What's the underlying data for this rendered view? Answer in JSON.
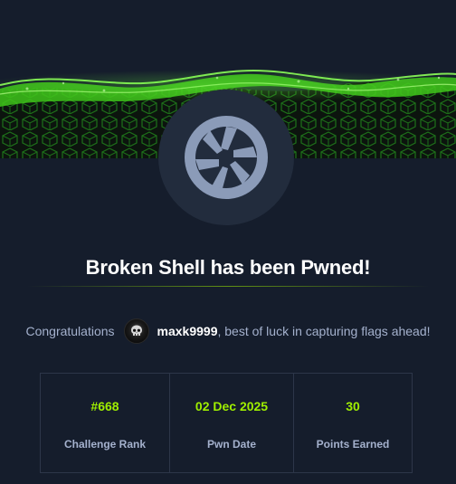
{
  "title": "Broken Shell has been Pwned!",
  "congrats": {
    "prefix": "Congratulations",
    "username": "maxk9999",
    "suffix": ", best of luck in capturing flags ahead!"
  },
  "stats": [
    {
      "value": "#668",
      "label": "Challenge Rank"
    },
    {
      "value": "02 Dec 2025",
      "label": "Pwn Date"
    },
    {
      "value": "30",
      "label": "Points Earned"
    }
  ],
  "colors": {
    "background": "#151d2c",
    "accent": "#9fef00",
    "logo_circle": "#222c3d",
    "logo_fill": "#8b9bb8",
    "title": "#ffffff",
    "muted_text": "#a4b1cd"
  },
  "icons": {
    "hero": "green-wave-cubes-banner",
    "logo": "camera-aperture-icon",
    "avatar": "skull-avatar-icon"
  }
}
